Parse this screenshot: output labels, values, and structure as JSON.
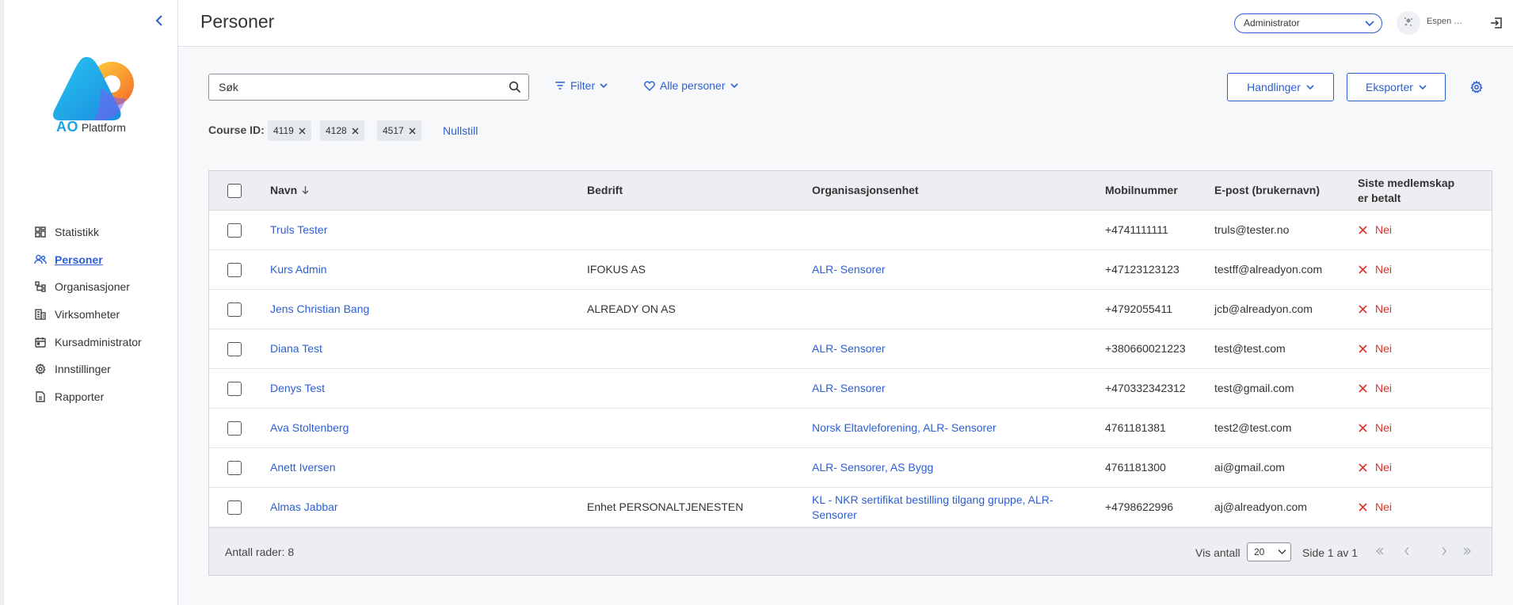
{
  "header": {
    "title": "Personer",
    "role_select_value": "Administrator",
    "user_name": "Espen …"
  },
  "sidebar": {
    "logo_ao": "AO",
    "logo_text": "Plattform",
    "items": [
      {
        "label": "Statistikk",
        "icon": "dashboard-icon",
        "active": false
      },
      {
        "label": "Personer",
        "icon": "people-icon",
        "active": true
      },
      {
        "label": "Organisasjoner",
        "icon": "org-tree-icon",
        "active": false
      },
      {
        "label": "Virksomheter",
        "icon": "building-icon",
        "active": false
      },
      {
        "label": "Kursadministrator",
        "icon": "calendar-icon",
        "active": false
      },
      {
        "label": "Innstillinger",
        "icon": "gear-icon",
        "active": false
      },
      {
        "label": "Rapporter",
        "icon": "report-icon",
        "active": false
      }
    ]
  },
  "toolbar": {
    "search_placeholder": "Søk",
    "filter_label": "Filter",
    "view_label": "Alle personer",
    "actions_label": "Handlinger",
    "export_label": "Eksporter"
  },
  "filters": {
    "label": "Course ID:",
    "chips": [
      "4119",
      "4128",
      "4517"
    ],
    "reset_label": "Nullstill"
  },
  "table": {
    "columns": {
      "name": "Navn",
      "company": "Bedrift",
      "org_unit": "Organisasjonsenhet",
      "mobile": "Mobilnummer",
      "email": "E-post (brukernavn)",
      "membership_line1": "Siste medlemskap",
      "membership_line2": "er betalt"
    },
    "rows": [
      {
        "name": "Truls Tester",
        "company": "",
        "org_unit": "",
        "mobile": "+4741111111",
        "email": "truls@tester.no",
        "paid": "Nei"
      },
      {
        "name": "Kurs Admin",
        "company": "IFOKUS AS",
        "org_unit": "ALR- Sensorer",
        "mobile": "+47123123123",
        "email": "testff@alreadyon.com",
        "paid": "Nei"
      },
      {
        "name": "Jens Christian Bang",
        "company": "ALREADY ON AS",
        "org_unit": "",
        "mobile": "+4792055411",
        "email": "jcb@alreadyon.com",
        "paid": "Nei"
      },
      {
        "name": "Diana Test",
        "company": "",
        "org_unit": "ALR- Sensorer",
        "mobile": "+380660021223",
        "email": "test@test.com",
        "paid": "Nei"
      },
      {
        "name": "Denys Test",
        "company": "",
        "org_unit": "ALR- Sensorer",
        "mobile": "+470332342312",
        "email": "test@gmail.com",
        "paid": "Nei"
      },
      {
        "name": "Ava Stoltenberg",
        "company": "",
        "org_unit": "Norsk Eltavleforening, ALR- Sensorer",
        "mobile": "4761181381",
        "email": "test2@test.com",
        "paid": "Nei"
      },
      {
        "name": "Anett Iversen",
        "company": "",
        "org_unit": "ALR- Sensorer, AS Bygg",
        "mobile": "4761181300",
        "email": "ai@gmail.com",
        "paid": "Nei"
      },
      {
        "name": "Almas Jabbar",
        "company": "Enhet PERSONALTJENESTEN",
        "org_unit": "KL - NKR sertifikat bestilling tilgang gruppe, ALR-Sensorer",
        "mobile": "+4798622996",
        "email": "aj@alreadyon.com",
        "paid": "Nei"
      }
    ]
  },
  "footer": {
    "row_count": "Antall rader: 8",
    "page_size_label": "Vis antall",
    "page_size_value": "20",
    "page_info": "Side 1 av 1"
  },
  "colors": {
    "accent": "#2c5fd1",
    "negative": "#d9312b",
    "header_bg": "#eceef1"
  }
}
